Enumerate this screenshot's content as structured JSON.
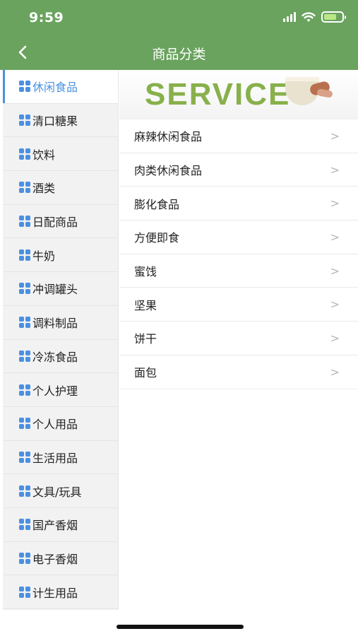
{
  "status_bar": {
    "time": "9:59"
  },
  "nav": {
    "title": "商品分类",
    "back_icon": "chevron-left-icon"
  },
  "sidebar": {
    "items": [
      {
        "label": "休闲食品",
        "active": true
      },
      {
        "label": "清口糖果",
        "active": false
      },
      {
        "label": "饮料",
        "active": false
      },
      {
        "label": "酒类",
        "active": false
      },
      {
        "label": "日配商品",
        "active": false
      },
      {
        "label": "牛奶",
        "active": false
      },
      {
        "label": "冲调罐头",
        "active": false
      },
      {
        "label": "调料制品",
        "active": false
      },
      {
        "label": "冷冻食品",
        "active": false
      },
      {
        "label": "个人护理",
        "active": false
      },
      {
        "label": "个人用品",
        "active": false
      },
      {
        "label": "生活用品",
        "active": false
      },
      {
        "label": "文具/玩具",
        "active": false
      },
      {
        "label": "国产香烟",
        "active": false
      },
      {
        "label": "电子香烟",
        "active": false
      },
      {
        "label": "计生用品",
        "active": false
      }
    ]
  },
  "banner": {
    "text": "SERVICE"
  },
  "subcategories": {
    "chevron": ">",
    "items": [
      {
        "label": "麻辣休闲食品"
      },
      {
        "label": "肉类休闲食品"
      },
      {
        "label": "膨化食品"
      },
      {
        "label": "方便即食"
      },
      {
        "label": "蜜饯"
      },
      {
        "label": "坚果"
      },
      {
        "label": "饼干"
      },
      {
        "label": "面包"
      }
    ]
  },
  "colors": {
    "header": "#6aa35e",
    "accent": "#4a90e2",
    "sidebar_bg": "#f2f2f2"
  }
}
